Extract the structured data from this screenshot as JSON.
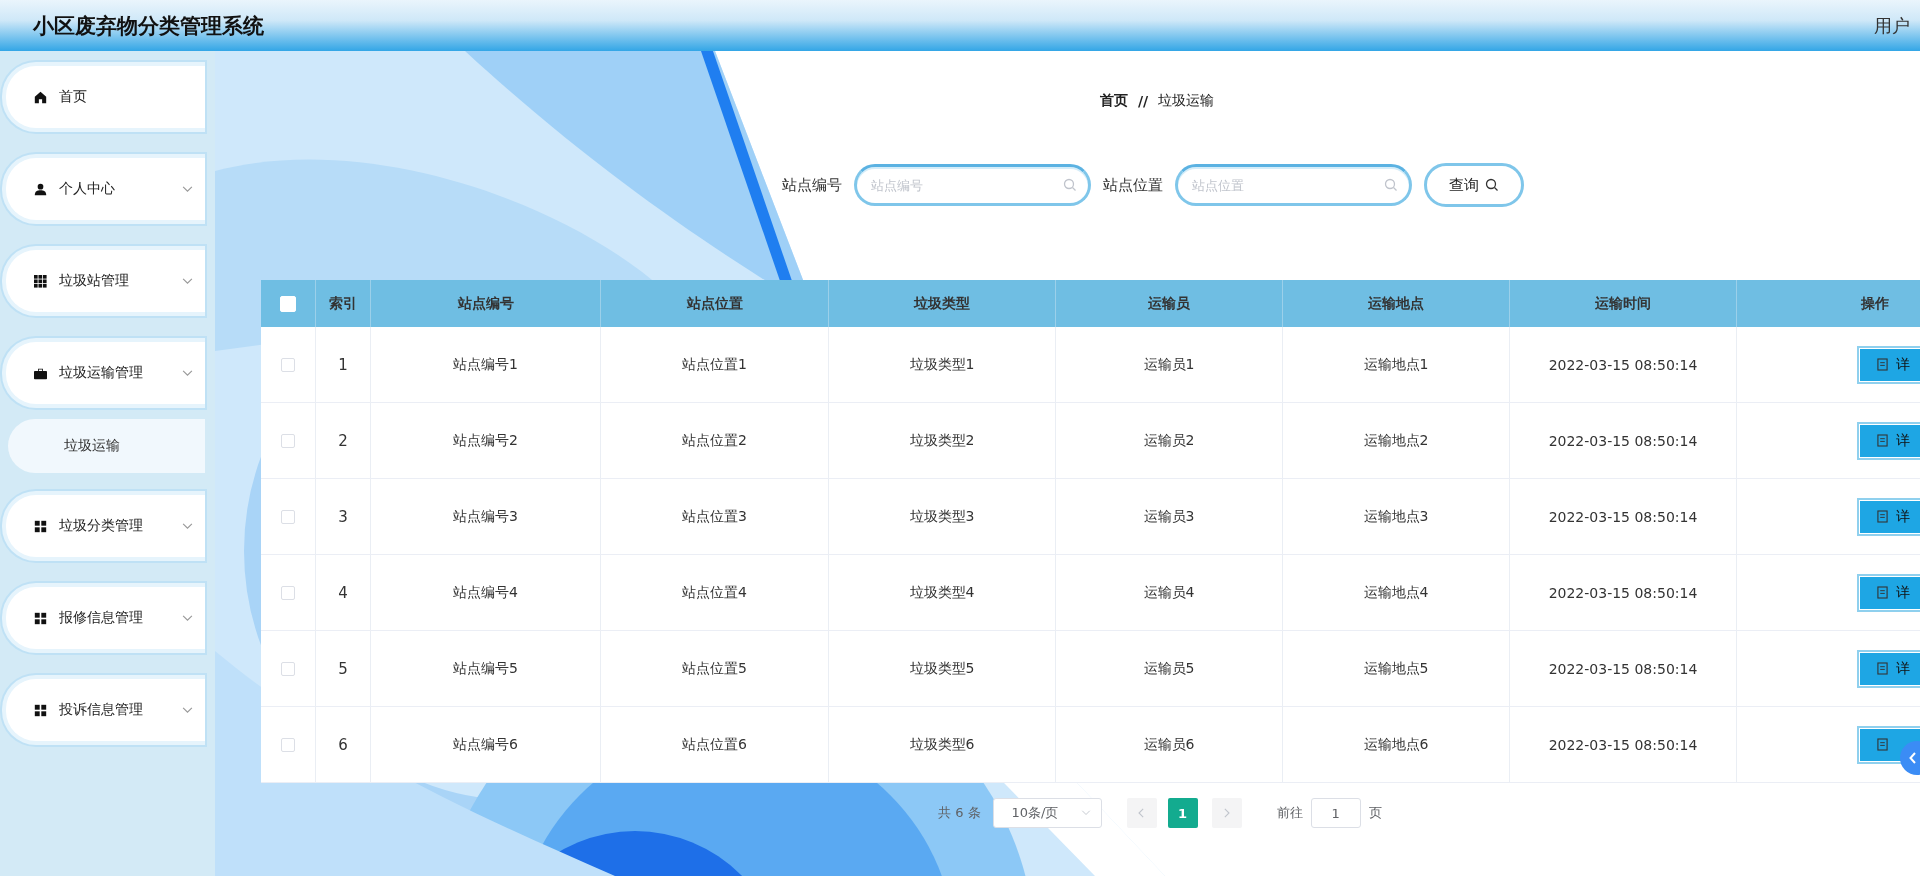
{
  "header": {
    "title": "小区废弃物分类管理系统",
    "user": "用户"
  },
  "sidebar": {
    "items": [
      {
        "label": "首页",
        "dropdown": false,
        "selected": false
      },
      {
        "label": "个人中心",
        "dropdown": true,
        "selected": false
      },
      {
        "label": "垃圾站管理",
        "dropdown": true,
        "selected": false
      },
      {
        "label": "垃圾运输管理",
        "dropdown": true,
        "selected": false,
        "children": [
          {
            "label": "垃圾运输",
            "selected": true
          }
        ]
      },
      {
        "label": "垃圾分类管理",
        "dropdown": true,
        "selected": false
      },
      {
        "label": "报修信息管理",
        "dropdown": true,
        "selected": false
      },
      {
        "label": "投诉信息管理",
        "dropdown": true,
        "selected": false
      }
    ]
  },
  "breadcrumb": {
    "home": "首页",
    "separator": "//",
    "current": "垃圾运输"
  },
  "search": {
    "fields": [
      {
        "label": "站点编号",
        "placeholder": "站点编号"
      },
      {
        "label": "站点位置",
        "placeholder": "站点位置"
      }
    ],
    "button": "查询"
  },
  "table": {
    "header_checked": false,
    "columns": [
      "索引",
      "站点编号",
      "站点位置",
      "垃圾类型",
      "运输员",
      "运输地点",
      "运输时间",
      "操作"
    ],
    "rows": [
      {
        "checked": false,
        "cells": [
          "1",
          "站点编号1",
          "站点位置1",
          "垃圾类型1",
          "运输员1",
          "运输地点1",
          "2022-03-15 08:50:14"
        ],
        "action": "详"
      },
      {
        "checked": false,
        "cells": [
          "2",
          "站点编号2",
          "站点位置2",
          "垃圾类型2",
          "运输员2",
          "运输地点2",
          "2022-03-15 08:50:14"
        ],
        "action": "详"
      },
      {
        "checked": false,
        "cells": [
          "3",
          "站点编号3",
          "站点位置3",
          "垃圾类型3",
          "运输员3",
          "运输地点3",
          "2022-03-15 08:50:14"
        ],
        "action": "详"
      },
      {
        "checked": false,
        "cells": [
          "4",
          "站点编号4",
          "站点位置4",
          "垃圾类型4",
          "运输员4",
          "运输地点4",
          "2022-03-15 08:50:14"
        ],
        "action": "详"
      },
      {
        "checked": false,
        "cells": [
          "5",
          "站点编号5",
          "站点位置5",
          "垃圾类型5",
          "运输员5",
          "运输地点5",
          "2022-03-15 08:50:14"
        ],
        "action": "详"
      },
      {
        "checked": false,
        "cells": [
          "6",
          "站点编号6",
          "站点位置6",
          "垃圾类型6",
          "运输员6",
          "运输地点6",
          "2022-03-15 08:50:14"
        ]
      }
    ]
  },
  "pagination": {
    "total": "共 6 条",
    "page_size": "10条/页",
    "pages": [
      {
        "label": "1",
        "selected": true
      }
    ],
    "goto_label": "前往",
    "goto_value": "1",
    "goto_suffix": "页"
  }
}
